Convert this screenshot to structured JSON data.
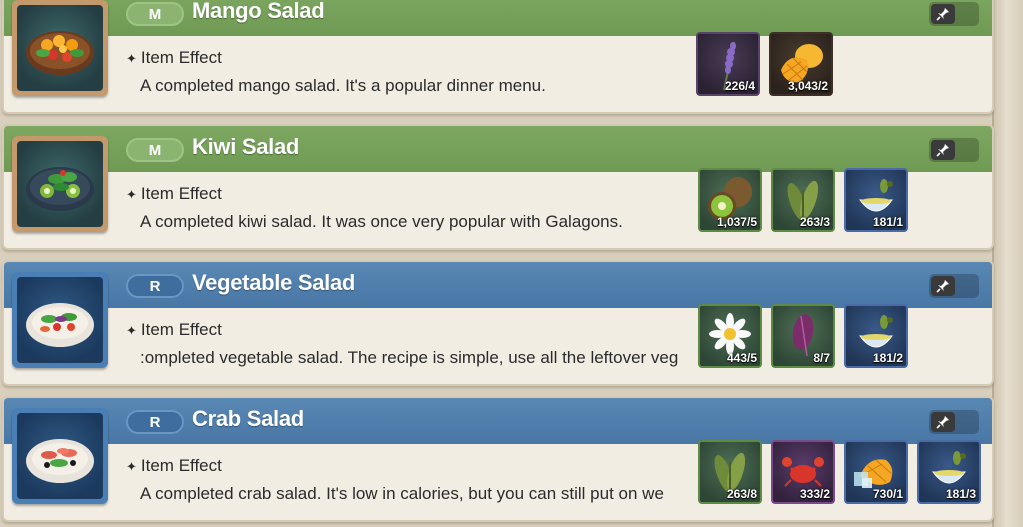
{
  "effect_label": "Item Effect",
  "items": [
    {
      "grade": "M",
      "name": "Mango Salad",
      "description": "A completed mango salad. It's a popular dinner menu.",
      "header_color": "#76a15a",
      "thumb_icon": "mango-salad-icon",
      "ingredients": [
        {
          "icon": "lavender-icon",
          "count": "226/4"
        },
        {
          "icon": "mango-icon",
          "count": "3,043/2"
        }
      ]
    },
    {
      "grade": "M",
      "name": "Kiwi Salad",
      "description": "A completed kiwi salad. It was once very popular with Galagons.",
      "header_color": "#76a15a",
      "thumb_icon": "kiwi-salad-icon",
      "ingredients": [
        {
          "icon": "kiwi-icon",
          "count": "1,037/5"
        },
        {
          "icon": "herb-leaves-icon",
          "count": "263/3"
        },
        {
          "icon": "olive-oil-icon",
          "count": "181/1"
        }
      ]
    },
    {
      "grade": "R",
      "name": "Vegetable Salad",
      "description": ":ompleted vegetable salad. The recipe is simple, use all the leftover veg",
      "header_color": "#4f7fae",
      "thumb_icon": "vegetable-salad-icon",
      "ingredients": [
        {
          "icon": "chamomile-icon",
          "count": "443/5"
        },
        {
          "icon": "purple-leaf-icon",
          "count": "8/7"
        },
        {
          "icon": "olive-oil-icon",
          "count": "181/2"
        }
      ]
    },
    {
      "grade": "R",
      "name": "Crab Salad",
      "description": "A completed crab salad. It's low in calories, but you can still put on we",
      "header_color": "#4f7fae",
      "thumb_icon": "crab-salad-icon",
      "ingredients": [
        {
          "icon": "herb-leaves-icon",
          "count": "263/8"
        },
        {
          "icon": "crab-icon",
          "count": "333/2"
        },
        {
          "icon": "frozen-mango-icon",
          "count": "730/1"
        },
        {
          "icon": "olive-oil-icon",
          "count": "181/3"
        }
      ]
    }
  ]
}
